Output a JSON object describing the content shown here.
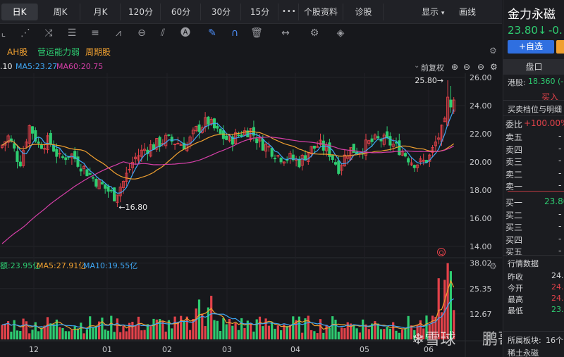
{
  "tabs": {
    "periods": [
      "日K",
      "周K",
      "月K",
      "120分",
      "60分",
      "30分",
      "15分"
    ],
    "more": "•••",
    "profile": "个股资料",
    "diagnosis": "诊股",
    "display": "显示",
    "drawing": "画线"
  },
  "toolbar": {
    "icons": [
      "crosshair-icon",
      "fan-icon",
      "wave-icon",
      "bars-icon",
      "rows-icon",
      "zigzag-icon",
      "cycle-icon",
      "fork-icon",
      "text-box-icon",
      "pen-icon",
      "magnet-icon",
      "trash-icon",
      "resize-icon",
      "gear-icon",
      "layers-icon"
    ]
  },
  "indicators": {
    "ah": "AH股",
    "ops": "营运能力弱",
    "cycle": "周期股"
  },
  "ma": {
    "first": ".10",
    "ma5": "MA5:23.27",
    "ma60": "MA60:20.75",
    "adjust": "前复权"
  },
  "volume_labels": {
    "amount": "额:23.95亿",
    "ma5": "MA5:27.91亿",
    "ma10": "MA10:19.55亿"
  },
  "price_axis": [
    "26.00",
    "24.00",
    "22.00",
    "20.00",
    "18.00",
    "16.00",
    "14.00"
  ],
  "volume_axis": [
    "38.02",
    "25.35",
    "12.67"
  ],
  "month_labels": [
    "12",
    "01",
    "02",
    "03",
    "04",
    "05",
    "06"
  ],
  "annotations": {
    "high": "25.80→",
    "low": "←16.80",
    "q_marker": "Q"
  },
  "watermark": {
    "logo": "雪球",
    "author": "鹏哥投研"
  },
  "chart_data": {
    "type": "candlestick",
    "price_range": [
      13.2,
      26.3
    ],
    "volume_range": [
      0,
      40
    ],
    "high_label": 25.8,
    "low_label": 16.8
  },
  "right_panel": {
    "name": "金力永磁",
    "price": "23.80↓",
    "change": "-0.",
    "add_watch": "+自选",
    "panel_title": "盘口",
    "hk_label": "港股:",
    "hk_price": "18.360 (-",
    "buy_in": "买入",
    "depth_title": "买卖档位与明细",
    "ratio_label": "委比",
    "ratio_value": "+100.00%",
    "asks": [
      "卖五",
      "卖四",
      "卖三",
      "卖二",
      "卖一"
    ],
    "ask_vals": [
      "-",
      "-",
      "-",
      "-",
      "-"
    ],
    "bids": [
      "买一",
      "买二",
      "买三",
      "买四",
      "买五"
    ],
    "bid_first": "23.80",
    "bid_vals": [
      "-",
      "-",
      "-",
      "-"
    ],
    "market_title": "行情数据",
    "market_rows": [
      "昨收",
      "今开",
      "最高",
      "最低"
    ],
    "market_vals": [
      "24.",
      "24.",
      "24.",
      "23."
    ],
    "sector_label": "所属板块:",
    "sector_count": "16个",
    "sector_name": "稀土永磁"
  },
  "colors": {
    "up": "#e3424a",
    "down": "#2ecc71",
    "ma5": "#f0f0f0",
    "ma10": "#f0a030",
    "ma20": "#3fa7f5",
    "ma60": "#d63fa8",
    "accent": "#4d8df6"
  }
}
